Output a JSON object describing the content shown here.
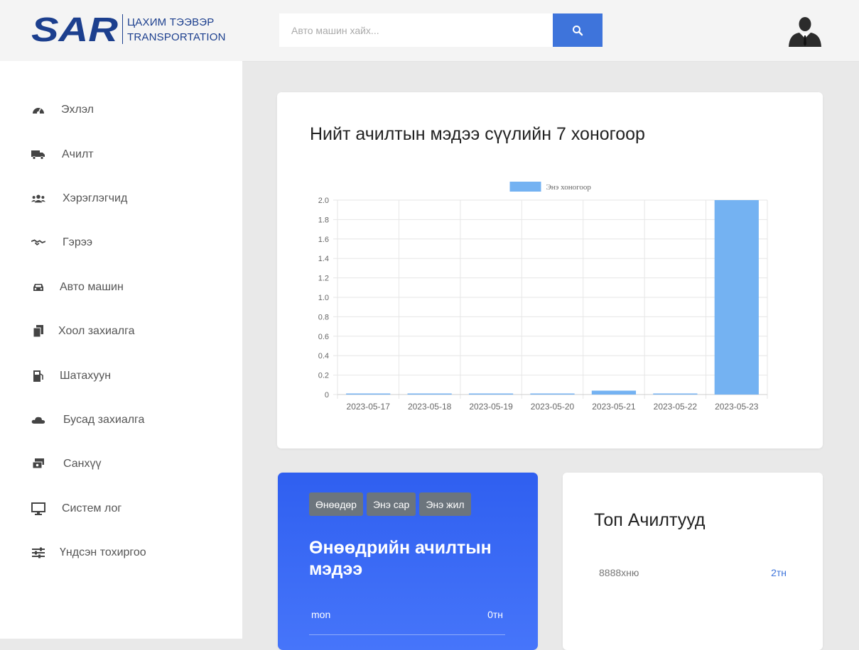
{
  "app": {
    "logo_letters": "SAR",
    "logo_line1": "ЦАХИМ ТЭЭВЭР",
    "logo_line2": "TRANSPORTATION"
  },
  "colors": {
    "accent": "#3e74db",
    "brand": "#1c3f8e",
    "chart_bar": "#74b2f2"
  },
  "search": {
    "placeholder": "Авто машин хайх..."
  },
  "sidebar": {
    "items": [
      {
        "label": "Эхлэл",
        "icon": "dashboard-gauge-icon"
      },
      {
        "label": "Ачилт",
        "icon": "truck-icon"
      },
      {
        "label": "Хэрэглэгчид",
        "icon": "users-icon"
      },
      {
        "label": "Гэрээ",
        "icon": "handshake-icon"
      },
      {
        "label": "Авто машин",
        "icon": "car-icon"
      },
      {
        "label": "Хоол захиалга",
        "icon": "documents-icon"
      },
      {
        "label": "Шатахуун",
        "icon": "gas-pump-icon"
      },
      {
        "label": "Бусад захиалга",
        "icon": "cloud-icon"
      },
      {
        "label": "Санхүү",
        "icon": "money-icon"
      },
      {
        "label": "Систем лог",
        "icon": "monitor-icon"
      },
      {
        "label": "Үндсэн тохиргоо",
        "icon": "sliders-icon"
      }
    ]
  },
  "chart_card": {
    "title": "Нийт ачилтын мэдээ сүүлийн 7 хоногоор"
  },
  "chart_data": {
    "type": "bar",
    "categories": [
      "2023-05-17",
      "2023-05-18",
      "2023-05-19",
      "2023-05-20",
      "2023-05-21",
      "2023-05-22",
      "2023-05-23"
    ],
    "series": [
      {
        "name": "Энэ хоногоор",
        "values": [
          0,
          0,
          0,
          0,
          0.04,
          0,
          2
        ]
      }
    ],
    "ylim": [
      0,
      2
    ],
    "yticks": [
      "0",
      "0.2",
      "0.4",
      "0.6",
      "0.8",
      "1.0",
      "1.2",
      "1.4",
      "1.6",
      "1.8",
      "2.0"
    ],
    "grid": true,
    "legend": "top-center"
  },
  "today_card": {
    "tabs": [
      "Өнөөдөр",
      "Энэ сар",
      "Энэ жил"
    ],
    "title": "Өнөөдрийн ачилтын мэдээ",
    "row": {
      "name": "mon",
      "value": "0тн"
    }
  },
  "top_card": {
    "title": "Топ Ачилтууд",
    "rows": [
      {
        "name": "8888хню",
        "value": "2тн"
      }
    ]
  }
}
